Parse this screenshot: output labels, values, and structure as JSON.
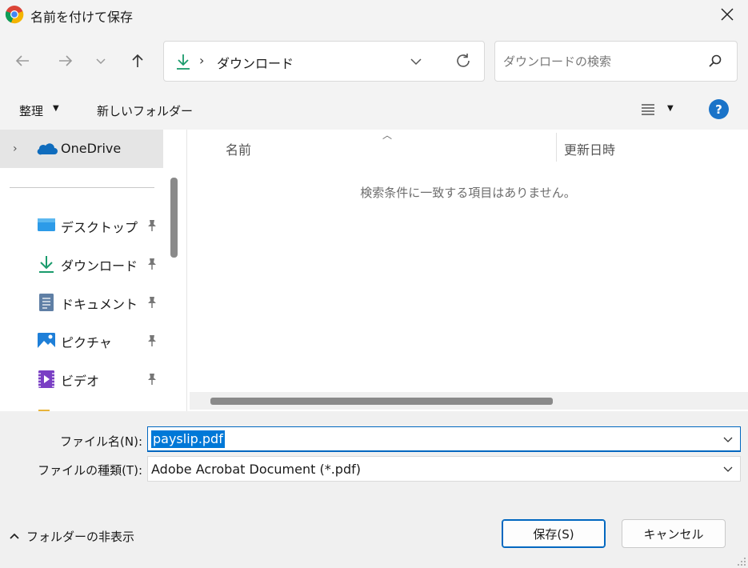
{
  "window": {
    "title": "名前を付けて保存"
  },
  "nav": {
    "breadcrumb_separator": "›",
    "address": "ダウンロード",
    "search_placeholder": "ダウンロードの検索"
  },
  "toolbar": {
    "organize_label": "整理",
    "new_folder_label": "新しいフォルダー",
    "help_label": "?"
  },
  "sidebar": {
    "onedrive_label": "OneDrive",
    "items": [
      {
        "label": "デスクトップ",
        "icon": "desktop-icon"
      },
      {
        "label": "ダウンロード",
        "icon": "download-icon"
      },
      {
        "label": "ドキュメント",
        "icon": "document-icon"
      },
      {
        "label": "ピクチャ",
        "icon": "pictures-icon"
      },
      {
        "label": "ビデオ",
        "icon": "video-icon"
      }
    ]
  },
  "content": {
    "columns": [
      "名前",
      "更新日時"
    ],
    "empty_message": "検索条件に一致する項目はありません。"
  },
  "form": {
    "filename_label": "ファイル名(N):",
    "filename_value": "payslip.pdf",
    "filetype_label": "ファイルの種類(T):",
    "filetype_value": "Adobe Acrobat Document (*.pdf)"
  },
  "footer": {
    "hide_folders_label": "フォルダーの非表示",
    "save_label": "保存(S)",
    "cancel_label": "キャンセル"
  },
  "colors": {
    "accent": "#0067c0",
    "selection": "#0078d7",
    "download_green": "#1a9b6c",
    "help_blue": "#1a73c8"
  }
}
